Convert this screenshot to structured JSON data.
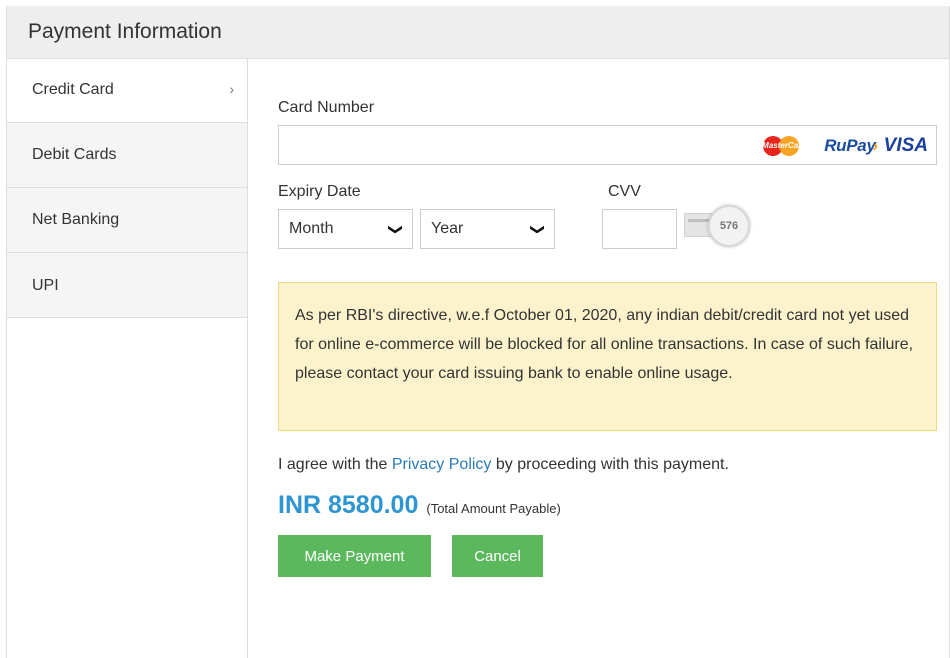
{
  "header": {
    "title": "Payment Information"
  },
  "sidebar": {
    "items": [
      {
        "label": "Credit Card",
        "active": true,
        "chevron": "›"
      },
      {
        "label": "Debit Cards",
        "active": false
      },
      {
        "label": "Net Banking",
        "active": false
      },
      {
        "label": "UPI",
        "active": false
      }
    ]
  },
  "form": {
    "card_number_label": "Card Number",
    "card_number_value": "",
    "card_logos": {
      "mastercard": "MasterCard",
      "rupay": "RuPay",
      "rupay_arrow": "›",
      "visa": "VISA"
    },
    "expiry_label": "Expiry Date",
    "month_value": "Month",
    "year_value": "Year",
    "caret": "❯",
    "cvv_label": "CVV",
    "cvv_value": "",
    "cvv_sample": "576"
  },
  "notice": {
    "text": "As per RBI's directive, w.e.f October 01, 2020, any indian debit/credit card not yet used for online e-commerce will be blocked for all online transactions. In case of such failure, please contact your card issuing bank to enable online usage."
  },
  "agreement": {
    "prefix": "I agree with the ",
    "link": "Privacy Policy",
    "suffix": " by proceeding with this payment."
  },
  "amount": {
    "value": "INR 8580.00",
    "note": "(Total Amount Payable)"
  },
  "buttons": {
    "make_payment": "Make Payment",
    "cancel": "Cancel"
  },
  "colors": {
    "accent_blue": "#2e95d3",
    "link_blue": "#2b7bb9",
    "button_green": "#5cb85c",
    "notice_bg": "#fcf3cd",
    "notice_border": "#f0d982"
  },
  "icons": {
    "chevron": "chevron-right-icon",
    "select_caret": "chevron-down-icon",
    "cvv_card": "cvv-card-icon"
  }
}
